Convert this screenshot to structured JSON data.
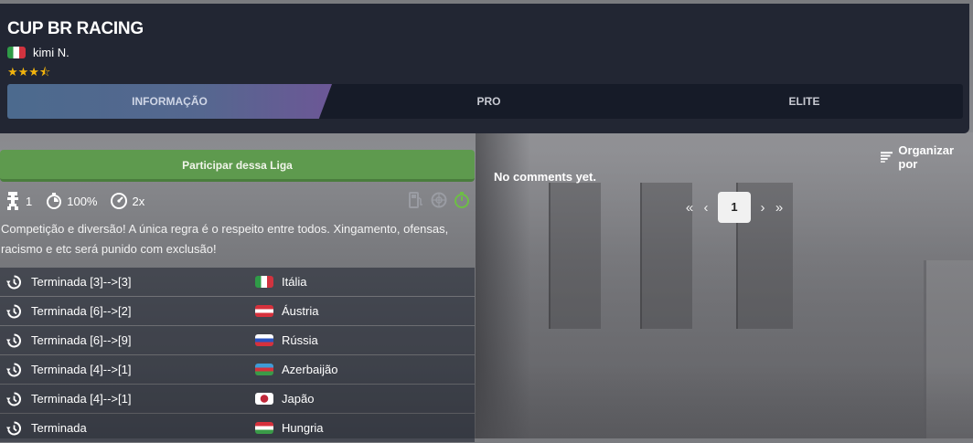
{
  "league": {
    "title": "CUP BR RACING",
    "owner": "kimi N.",
    "rating_stars": 3.5,
    "stars_glyphs": "★★★⯪"
  },
  "tabs": [
    {
      "label": "INFORMAÇÃO",
      "active": true
    },
    {
      "label": "PRO",
      "active": false
    },
    {
      "label": "ELITE",
      "active": false
    }
  ],
  "join_button": "Participar dessa Liga",
  "stats": {
    "pitstops": "1",
    "fuel": "100%",
    "tyre_wear": "2x"
  },
  "description": "Competição e diversão! A única regra é o respeito entre todos. Xingamento, ofensas, racismo e etc será punido com exclusão!",
  "events": [
    {
      "status": "Terminada [3]-->[3]",
      "country": "Itália",
      "flag": "italy"
    },
    {
      "status": "Terminada [6]-->[2]",
      "country": "Áustria",
      "flag": "austria"
    },
    {
      "status": "Terminada [6]-->[9]",
      "country": "Rússia",
      "flag": "russia"
    },
    {
      "status": "Terminada [4]-->[1]",
      "country": "Azerbaijão",
      "flag": "azerbaijan"
    },
    {
      "status": "Terminada [4]-->[1]",
      "country": "Japão",
      "flag": "japan"
    },
    {
      "status": "Terminada",
      "country": "Hungria",
      "flag": "hungary"
    }
  ],
  "comments": {
    "sort_label": "Organizar por",
    "empty_text": "No comments yet.",
    "current_page": "1"
  },
  "colors": {
    "header_bg": "#222633",
    "accent_green": "#5e9a4e",
    "star_gold": "#f1b30d"
  }
}
